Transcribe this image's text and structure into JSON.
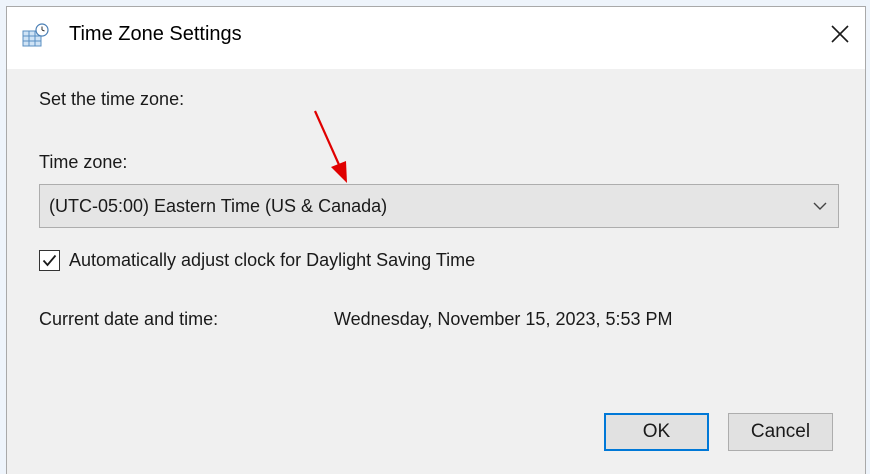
{
  "window": {
    "title": "Time Zone Settings",
    "icons": {
      "app": "time-zone-settings-icon",
      "close": "close-icon"
    }
  },
  "content": {
    "heading": "Set the time zone:",
    "time_zone_label": "Time zone:",
    "time_zone_value": "(UTC-05:00) Eastern Time (US & Canada)",
    "dst_checkbox": {
      "label": "Automatically adjust clock for Daylight Saving Time",
      "checked": true
    },
    "current_label": "Current date and time:",
    "current_value": "Wednesday, November 15, 2023, 5:53 PM"
  },
  "buttons": {
    "ok": "OK",
    "cancel": "Cancel"
  },
  "colors": {
    "accent": "#0078d7",
    "annotation_arrow": "#e00000",
    "dialog_bg": "#f0f0f0",
    "titlebar_bg": "#ffffff"
  }
}
